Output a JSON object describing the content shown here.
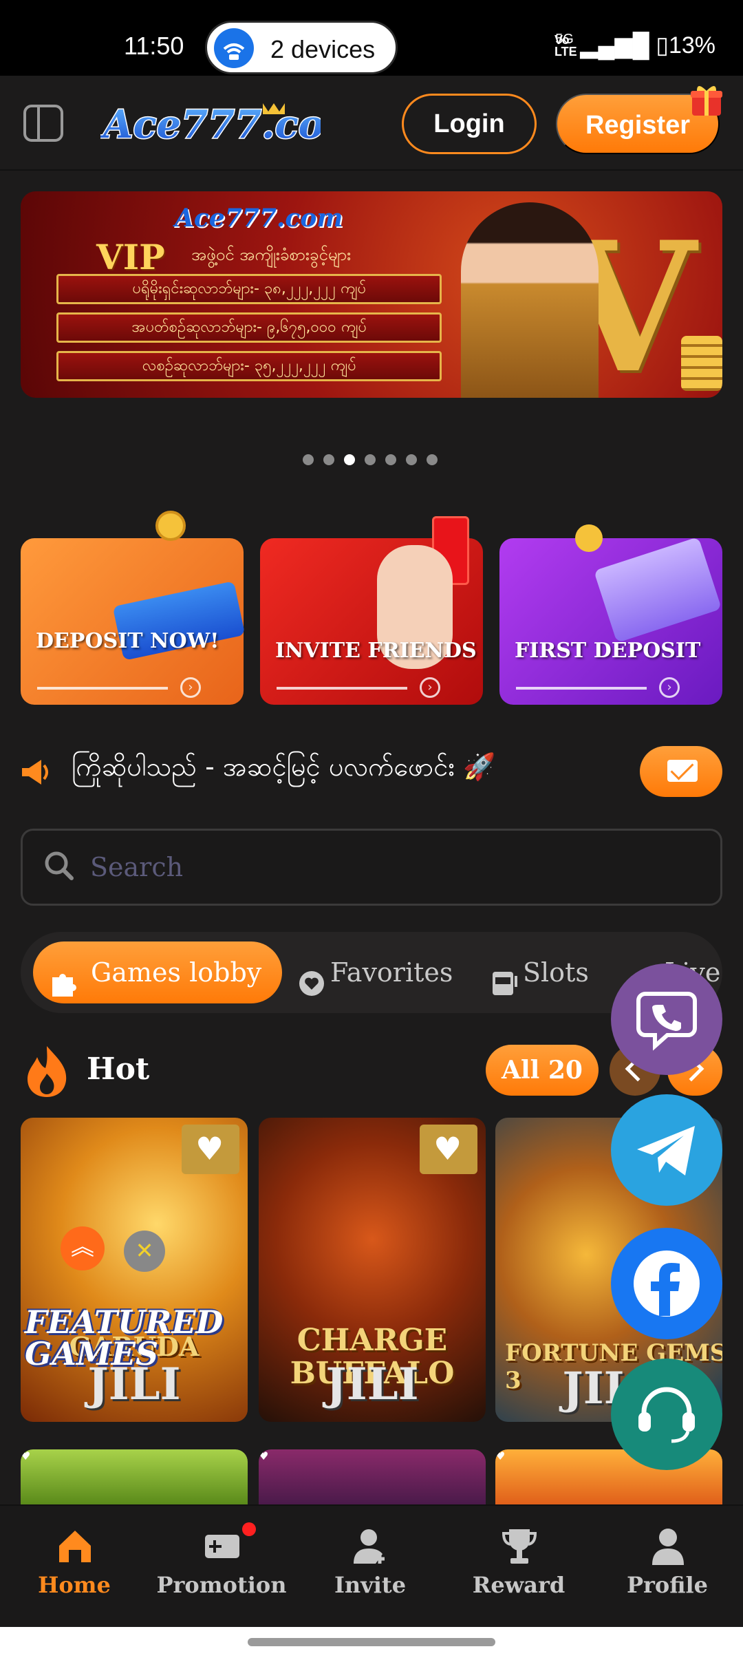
{
  "status_bar": {
    "time": "11:50",
    "devices": "2 devices",
    "network": "VoLTE",
    "signal": "5G",
    "battery": "13%"
  },
  "header": {
    "logo_text": "Ace777.com",
    "login_label": "Login",
    "register_label": "Register"
  },
  "banner": {
    "brand": "Ace777.com",
    "vip": "VIP",
    "subtitle": "အဖွဲ့ဝင် အကျိုးခံစားခွင့်များ",
    "rows": [
      "ပရိုမိုးရှင်းဆုလာဘ်များ- ၃၈,၂၂၂,၂၂၂ ကျပ်",
      "အပတ်စဉ်ဆုလာဘ်များ- ၉,၆၇၅,၀၀၀ ကျပ်",
      "လစဉ်ဆုလာဘ်များ- ၃၅,၂၂၂,၂၂၂ ကျပ်"
    ],
    "active_dot": 3,
    "dot_count": 7
  },
  "promos": [
    {
      "title": "DEPOSIT NOW!",
      "color": "#f07a26"
    },
    {
      "title": "INVITE FRIENDS",
      "color": "#e01818"
    },
    {
      "title": "FIRST DEPOSIT",
      "color": "#9b2ee0"
    }
  ],
  "marquee": {
    "text": "ကြိုဆိုပါသည် - အဆင့်မြင့် ပလက်ဖောင်း 🚀"
  },
  "search": {
    "placeholder": "Search"
  },
  "tabs": [
    {
      "label": "Games lobby",
      "icon": "puzzle-icon",
      "active": true
    },
    {
      "label": "Favorites",
      "icon": "heart-icon",
      "active": false
    },
    {
      "label": "Slots",
      "icon": "slot-machine-icon",
      "active": false
    },
    {
      "label": "Live",
      "icon": "live-icon",
      "active": false
    }
  ],
  "hot": {
    "title": "Hot",
    "all_label": "All",
    "count": "20"
  },
  "games": [
    {
      "name": "GARUDA",
      "provider": "JILI",
      "badge": "FEATURED GAMES"
    },
    {
      "name": "CHARGE BUFFALO",
      "provider": "JILI"
    },
    {
      "name": "FORTUNE GEMS 3",
      "provider": "JILI"
    }
  ],
  "social": [
    "viber-icon",
    "telegram-icon",
    "facebook-icon",
    "support-icon"
  ],
  "bottom_nav": [
    {
      "label": "Home",
      "icon": "home-icon",
      "active": true
    },
    {
      "label": "Promotion",
      "icon": "ticket-icon",
      "active": false,
      "dot": true
    },
    {
      "label": "Invite",
      "icon": "add-user-icon",
      "active": false
    },
    {
      "label": "Reward",
      "icon": "trophy-icon",
      "active": false
    },
    {
      "label": "Profile",
      "icon": "user-icon",
      "active": false
    }
  ],
  "colors": {
    "accent": "#ff8a1e",
    "background": "#1c1b1b"
  }
}
